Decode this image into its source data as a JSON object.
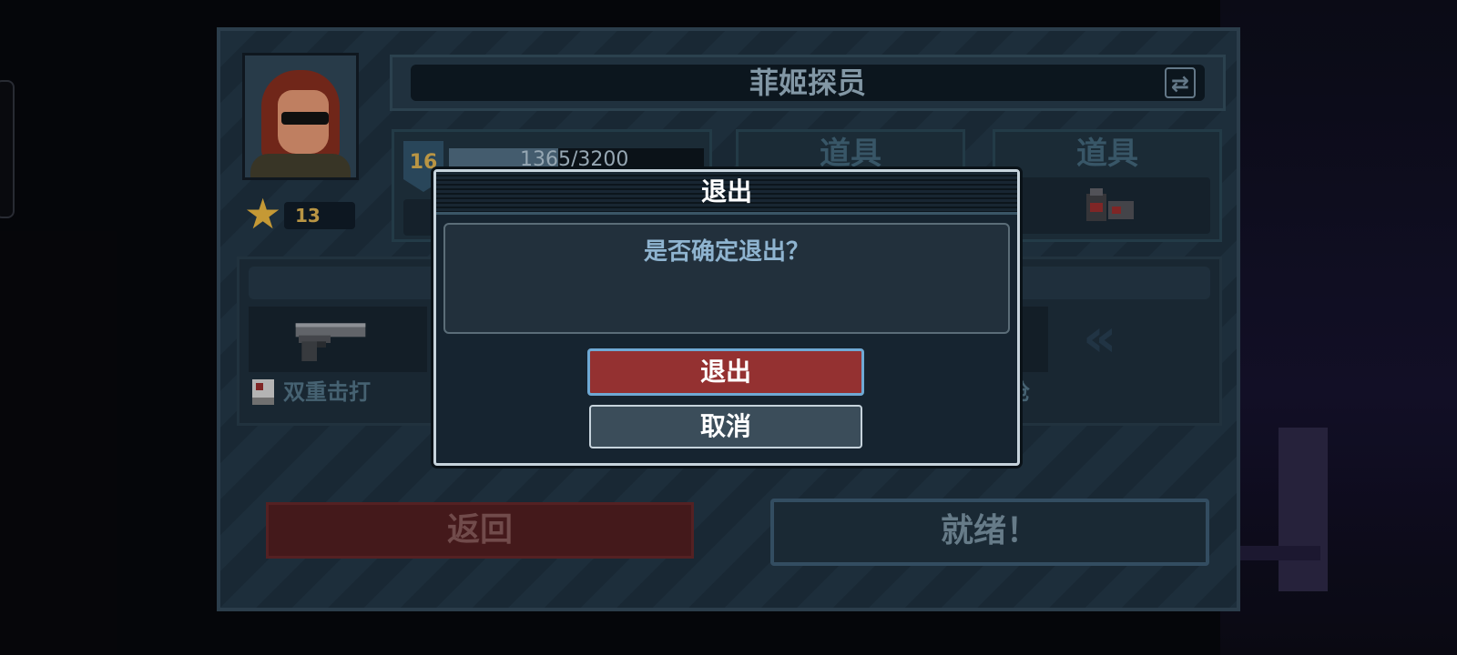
{
  "character": {
    "name": "菲姬探员",
    "rank": "13",
    "level": "16",
    "xp_text": "1365/3200",
    "xp_fraction": 0.43
  },
  "items": {
    "slot1_label": "道具",
    "slot2_label": "道具"
  },
  "weapons": {
    "primary_skill_label": "双重击打",
    "secondary_label_partial": "榛枪"
  },
  "buttons": {
    "back_label": "返回",
    "ready_label": "就绪！"
  },
  "dialog": {
    "title": "退出",
    "message": "是否确定退出？",
    "confirm_label": "退出",
    "cancel_label": "取消"
  },
  "colors": {
    "confirm_bg": "#943131",
    "dialog_border": "#c6d3dc",
    "message_text": "#8fb4d0",
    "rank_gold": "#d6a63a"
  }
}
